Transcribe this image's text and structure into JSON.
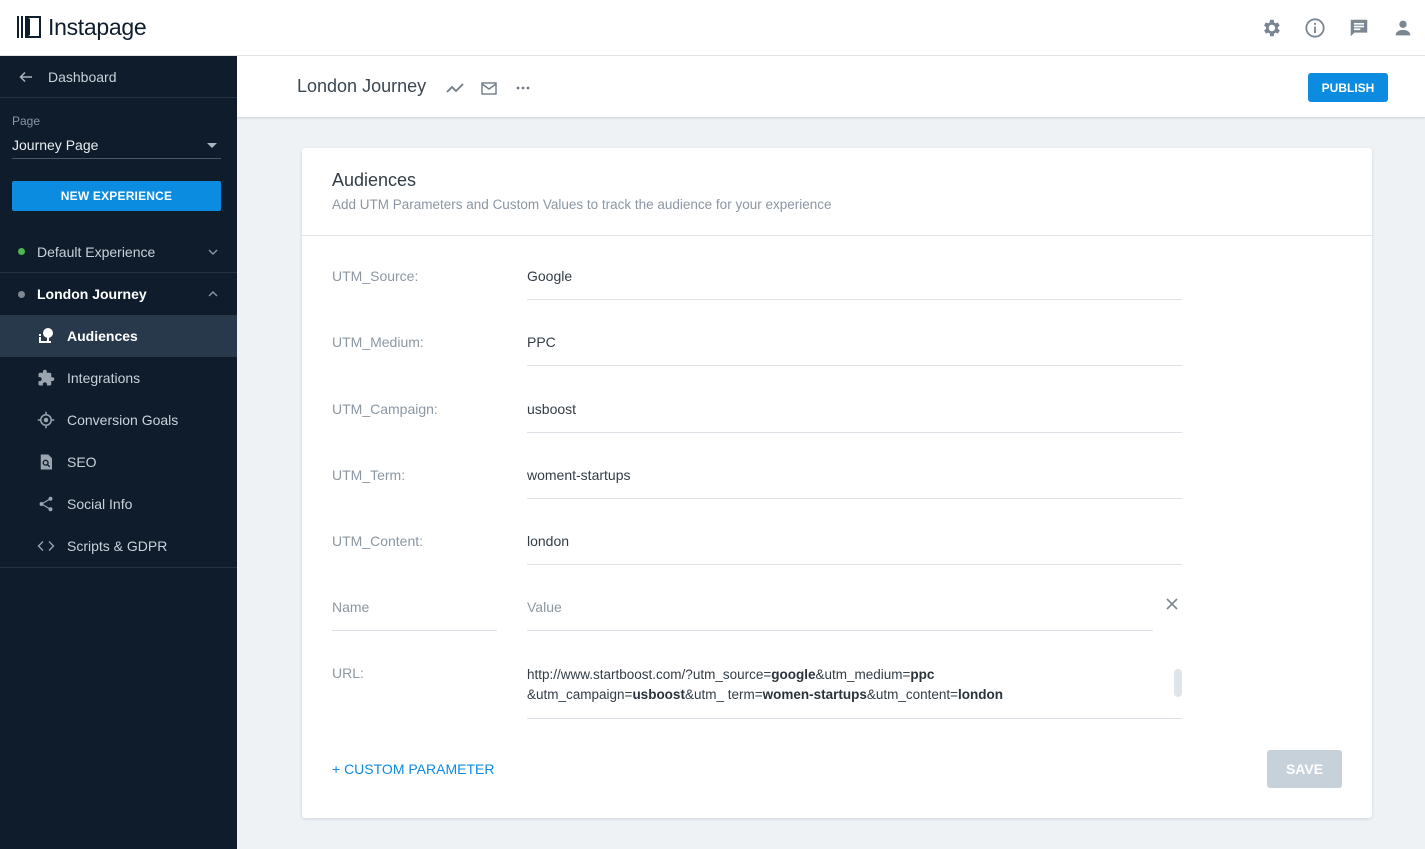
{
  "app": {
    "logo_text": "Instapage",
    "top_icons": [
      "gear-icon",
      "info-icon",
      "chat-icon",
      "user-icon"
    ]
  },
  "sidebar": {
    "back_label": "Dashboard",
    "page_label": "Page",
    "page_value": "Journey Page",
    "new_experience_label": "NEW EXPERIENCE",
    "experiences": [
      {
        "name": "Default Experience",
        "status_color": "#4cb84f",
        "expanded": false
      },
      {
        "name": "London Journey",
        "status_color": "#7f8891",
        "expanded": true
      }
    ],
    "nav_items": [
      {
        "label": "Audiences",
        "icon": "audiences-icon",
        "active": true
      },
      {
        "label": "Integrations",
        "icon": "puzzle-icon",
        "active": false
      },
      {
        "label": "Conversion Goals",
        "icon": "target-icon",
        "active": false
      },
      {
        "label": "SEO",
        "icon": "seo-icon",
        "active": false
      },
      {
        "label": "Social Info",
        "icon": "share-icon",
        "active": false
      },
      {
        "label": "Scripts & GDPR",
        "icon": "code-icon",
        "active": false
      }
    ]
  },
  "header": {
    "title": "London Journey",
    "publish_label": "PUBLISH"
  },
  "card": {
    "title": "Audiences",
    "subtitle": "Add UTM Parameters and Custom Values to track the audience for your experience",
    "fields": [
      {
        "label": "UTM_Source:",
        "value": "Google"
      },
      {
        "label": "UTM_Medium:",
        "value": "PPC"
      },
      {
        "label": "UTM_Campaign:",
        "value": "usboost"
      },
      {
        "label": "UTM_Term:",
        "value": "woment-startups"
      },
      {
        "label": "UTM_Content:",
        "value": "london"
      }
    ],
    "custom": {
      "name_placeholder": "Name",
      "value_placeholder": "Value"
    },
    "url": {
      "label": "URL:",
      "parts": [
        {
          "t": "http://www.startboost.com/?utm_source=",
          "b": false
        },
        {
          "t": "google",
          "b": true
        },
        {
          "t": "&utm_medium=",
          "b": false
        },
        {
          "t": "ppc",
          "b": true
        },
        {
          "t": "\n",
          "b": false
        },
        {
          "t": "&utm_campaign=",
          "b": false
        },
        {
          "t": "usboost",
          "b": true
        },
        {
          "t": "&utm_ term=",
          "b": false
        },
        {
          "t": "women-startups",
          "b": true
        },
        {
          "t": "&utm_content=",
          "b": false
        },
        {
          "t": "london",
          "b": true
        }
      ]
    },
    "add_custom_label": "+ CUSTOM PARAMETER",
    "save_label": "SAVE"
  }
}
